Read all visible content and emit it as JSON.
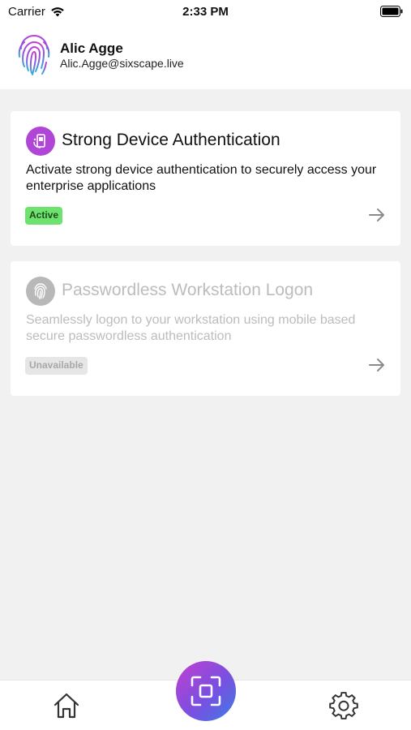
{
  "status_bar": {
    "carrier": "Carrier",
    "time": "2:33 PM"
  },
  "user": {
    "name": "Alic Agge",
    "email": "Alic.Agge@sixscape.live"
  },
  "cards": [
    {
      "title": "Strong Device Authentication",
      "description": "Activate strong device authentication to securely access your enterprise applications",
      "status": "Active",
      "icon": "device-auth-icon",
      "accent": "#b046d6"
    },
    {
      "title": "Passwordless Workstation Logon",
      "description": "Seamlessly logon to your workstation using mobile based secure passwordless authentication",
      "status": "Unavailable",
      "icon": "fingerprint-icon",
      "accent": "#b8b8b8"
    }
  ],
  "tab_bar": {
    "home_icon": "home-icon",
    "scan_icon": "scan-icon",
    "settings_icon": "gear-icon"
  },
  "colors": {
    "active_badge": "#6de36e",
    "background": "#f1f1f1",
    "scan_gradient": [
      "#c23fd2",
      "#3d7ce6"
    ]
  }
}
